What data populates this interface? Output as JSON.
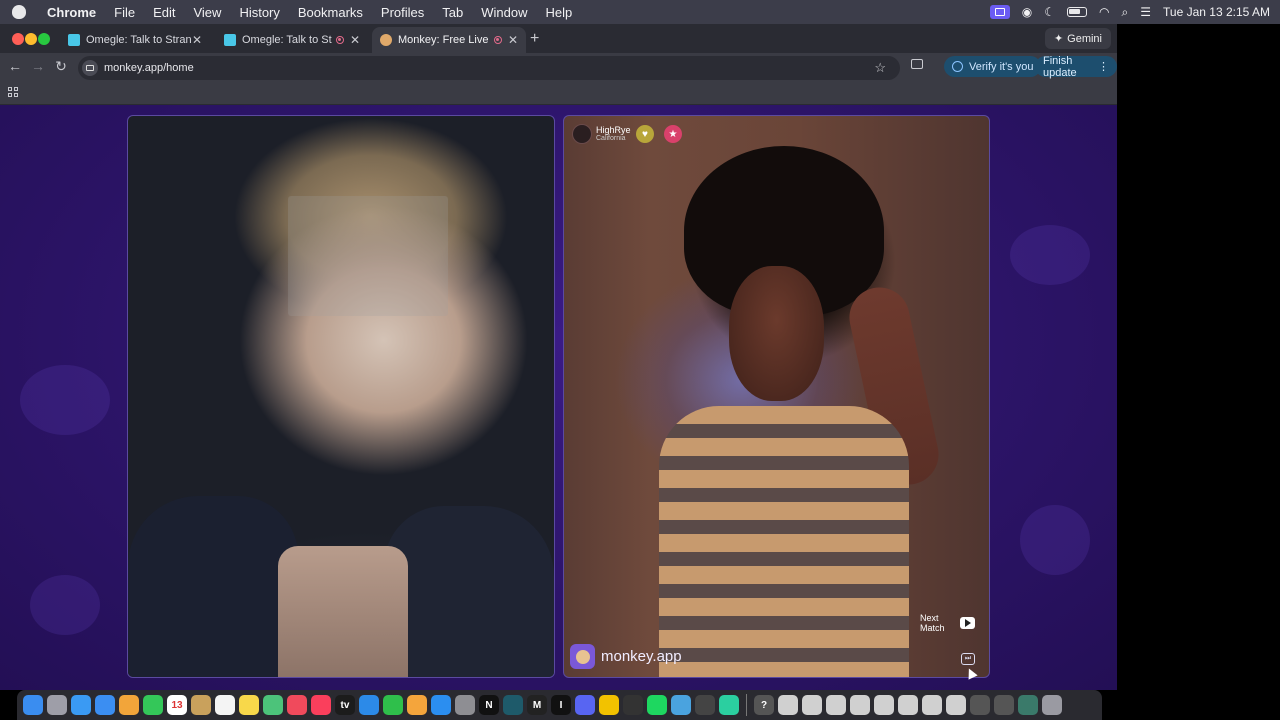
{
  "menubar": {
    "app_name": "Chrome",
    "items": [
      "File",
      "Edit",
      "View",
      "History",
      "Bookmarks",
      "Profiles",
      "Tab",
      "Window",
      "Help"
    ],
    "clock": "Tue Jan 13  2:15 AM"
  },
  "browser": {
    "tabs": [
      {
        "title": "Omegle: Talk to Strangers with",
        "favicon_color": "#49c7e8",
        "recording": false,
        "active": false
      },
      {
        "title": "Omegle: Talk to Strangers",
        "favicon_color": "#49c7e8",
        "recording": true,
        "active": false
      },
      {
        "title": "Monkey: Free Live Video C",
        "favicon_color": "#e0a96a",
        "recording": true,
        "active": true
      }
    ],
    "new_tab_label": "+",
    "gemini_label": "Gemini",
    "url": "monkey.app/home",
    "verify_label": "Verify it's you",
    "finish_update_label": "Finish update"
  },
  "call": {
    "remote_user": {
      "name": "HighRye",
      "location": "California"
    },
    "brand_text": "monkey.app",
    "next_match_label": "Next Match",
    "skip_icon": "fast-forward-icon"
  },
  "dock": {
    "icons": [
      {
        "name": "finder-icon",
        "color": "#3a8df0"
      },
      {
        "name": "launchpad-icon",
        "color": "#9e9ea8"
      },
      {
        "name": "safari-icon",
        "color": "#3a9af3"
      },
      {
        "name": "mail-icon",
        "color": "#3b8ef2"
      },
      {
        "name": "photos-icon",
        "color": "#f2a53a"
      },
      {
        "name": "messages-icon",
        "color": "#34c759"
      },
      {
        "name": "calendar-icon",
        "color": "#ffffff",
        "text": "13"
      },
      {
        "name": "notes-bar-icon",
        "color": "#c9a15c"
      },
      {
        "name": "reminders-icon",
        "color": "#f4f4f4"
      },
      {
        "name": "notes-icon",
        "color": "#f8d84a"
      },
      {
        "name": "maps-icon",
        "color": "#4cc37a"
      },
      {
        "name": "news-icon",
        "color": "#f04a5c"
      },
      {
        "name": "music-icon",
        "color": "#fa3f5c"
      },
      {
        "name": "tv-icon",
        "color": "#1c1c1c",
        "text": "tv"
      },
      {
        "name": "keynote-icon",
        "color": "#2c8ae8"
      },
      {
        "name": "numbers-icon",
        "color": "#2fbf4b"
      },
      {
        "name": "pages-icon",
        "color": "#f4a53c"
      },
      {
        "name": "app-store-icon",
        "color": "#2b8ef0"
      },
      {
        "name": "system-settings-icon",
        "color": "#8e8e93"
      },
      {
        "name": "netflix-icon",
        "color": "#111111",
        "text": "N"
      },
      {
        "name": "app-icon",
        "color": "#1e5a6a"
      },
      {
        "name": "medium-icon",
        "color": "#222222",
        "text": "M"
      },
      {
        "name": "app-i-icon",
        "color": "#111111",
        "text": "I"
      },
      {
        "name": "discord-icon",
        "color": "#5865f2"
      },
      {
        "name": "chrome-icon",
        "color": "#f2c200"
      },
      {
        "name": "piano-icon",
        "color": "#333333"
      },
      {
        "name": "spotify-icon",
        "color": "#1ed760"
      },
      {
        "name": "app2-icon",
        "color": "#4aa3df"
      },
      {
        "name": "app3-icon",
        "color": "#444444"
      },
      {
        "name": "app4-icon",
        "color": "#2bcfa0"
      },
      {
        "name": "help-icon",
        "color": "#555555",
        "text": "?"
      },
      {
        "name": "window-thumb-icon",
        "color": "#d0d0d0"
      },
      {
        "name": "window-thumb-icon",
        "color": "#d0d0d0"
      },
      {
        "name": "window-thumb-icon",
        "color": "#d0d0d0"
      },
      {
        "name": "window-thumb-icon",
        "color": "#d0d0d0"
      },
      {
        "name": "window-thumb-icon",
        "color": "#d0d0d0"
      },
      {
        "name": "window-thumb-icon",
        "color": "#d0d0d0"
      },
      {
        "name": "window-thumb-icon",
        "color": "#d0d0d0"
      },
      {
        "name": "window-thumb-icon",
        "color": "#d0d0d0"
      },
      {
        "name": "window-thumb-icon",
        "color": "#555555"
      },
      {
        "name": "window-thumb-icon",
        "color": "#555555"
      },
      {
        "name": "window-thumb-icon",
        "color": "#3a7a6a"
      },
      {
        "name": "trash-icon",
        "color": "#9a9aa2"
      }
    ]
  },
  "colors": {
    "page_bg": "#2c1468",
    "accent": "#7a58d8"
  }
}
